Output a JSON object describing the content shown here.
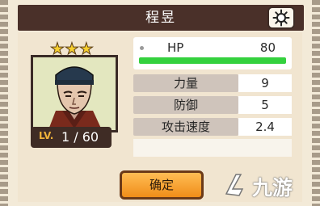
{
  "window": {
    "title": "程昱"
  },
  "hero": {
    "stars": 3,
    "level_prefix": "LV.",
    "level_value": "1 / 60"
  },
  "stats": {
    "hp_label": "HP",
    "hp_value": "80",
    "hp_fill_percent": 100,
    "rows": [
      {
        "label": "力量",
        "value": "9"
      },
      {
        "label": "防御",
        "value": "5"
      },
      {
        "label": "攻击速度",
        "value": "2.4"
      }
    ]
  },
  "buttons": {
    "confirm_label": "确定"
  },
  "watermark": {
    "text": "九游"
  },
  "icons": {
    "settings": "sun-icon"
  },
  "colors": {
    "titlebar": "#4a3029",
    "hp_green": "#34d13e",
    "star": "#f6cf2f",
    "confirm_button": "#f5a032"
  }
}
